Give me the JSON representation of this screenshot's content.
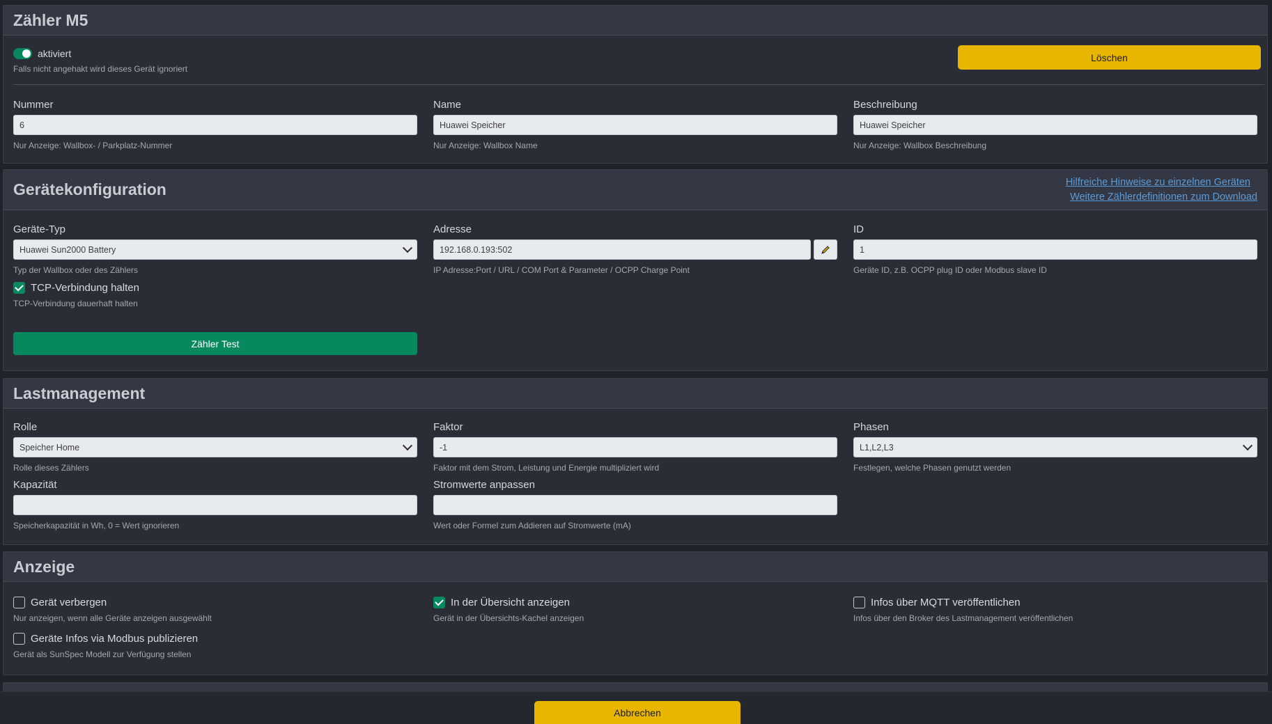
{
  "meter": {
    "title": "Zähler M5",
    "active_label": "aktiviert",
    "active_hint": "Falls nicht angehakt wird dieses Gerät ignoriert",
    "delete_label": "Löschen",
    "number_label": "Nummer",
    "number_value": "6",
    "number_hint": "Nur Anzeige: Wallbox- / Parkplatz-Nummer",
    "name_label": "Name",
    "name_value": "Huawei Speicher",
    "name_hint": "Nur Anzeige: Wallbox Name",
    "desc_label": "Beschreibung",
    "desc_value": "Huawei Speicher",
    "desc_hint": "Nur Anzeige: Wallbox Beschreibung"
  },
  "device_config": {
    "title": "Gerätekonfiguration",
    "link_hints": "Hilfreiche Hinweise zu einzelnen Geräten",
    "link_download": "Weitere Zählerdefinitionen zum Download",
    "type_label": "Geräte-Typ",
    "type_value": "Huawei Sun2000 Battery",
    "type_hint": "Typ der Wallbox oder des Zählers",
    "address_label": "Adresse",
    "address_value": "192.168.0.193:502",
    "address_hint": "IP Adresse:Port / URL / COM Port & Parameter / OCPP Charge Point",
    "id_label": "ID",
    "id_value": "1",
    "id_hint": "Geräte ID, z.B. OCPP plug ID oder Modbus slave ID",
    "tcp_label": "TCP-Verbindung halten",
    "tcp_hint": "TCP-Verbindung dauerhaft halten",
    "test_button": "Zähler Test"
  },
  "load_mgmt": {
    "title": "Lastmanagement",
    "role_label": "Rolle",
    "role_value": "Speicher Home",
    "role_hint": "Rolle dieses Zählers",
    "factor_label": "Faktor",
    "factor_value": "-1",
    "factor_hint": "Faktor mit dem Strom, Leistung und Energie multipliziert wird",
    "phases_label": "Phasen",
    "phases_value": "L1,L2,L3",
    "phases_hint": "Festlegen, welche Phasen genutzt werden",
    "capacity_label": "Kapazität",
    "capacity_value": "",
    "capacity_hint": "Speicherkapazität in Wh, 0 = Wert ignorieren",
    "current_adjust_label": "Stromwerte anpassen",
    "current_adjust_value": "",
    "current_adjust_hint": "Wert oder Formel zum Addieren auf Stromwerte (mA)"
  },
  "display": {
    "title": "Anzeige",
    "hide_label": "Gerät verbergen",
    "hide_hint": "Nur anzeigen, wenn alle Geräte anzeigen ausgewählt",
    "overview_label": "In der Übersicht anzeigen",
    "overview_hint": "Gerät in der Übersichts-Kachel anzeigen",
    "mqtt_label": "Infos über MQTT veröffentlichen",
    "mqtt_hint": "Infos über den Broker des Lastmanagement veröffentlichen",
    "modbus_label": "Geräte Infos via Modbus publizieren",
    "modbus_hint": "Gerät als SunSpec Modell zur Verfügung stellen"
  },
  "footer": {
    "cancel_label": "Abbrechen"
  },
  "colors": {
    "accent_yellow": "#e8b500",
    "accent_green": "#07885e",
    "link": "#5c9bd6"
  }
}
